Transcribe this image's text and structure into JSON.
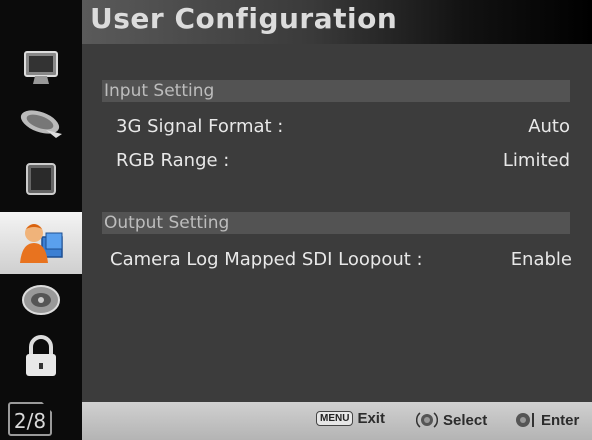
{
  "header": {
    "title": "User Configuration"
  },
  "sidebar": {
    "items": [
      {
        "icon": "monitor-icon"
      },
      {
        "icon": "satellite-dish-icon"
      },
      {
        "icon": "display-screen-icon"
      },
      {
        "icon": "user-config-icon",
        "active": true
      },
      {
        "icon": "settings-disc-icon"
      },
      {
        "icon": "lock-icon"
      }
    ],
    "page_indicator": "2/8"
  },
  "sections": {
    "input": {
      "title": "Input Setting",
      "rows": [
        {
          "label": "3G Signal Format :",
          "value": "Auto"
        },
        {
          "label": "RGB Range :",
          "value": "Limited"
        }
      ]
    },
    "output": {
      "title": "Output Setting",
      "rows": [
        {
          "label": "Camera Log Mapped SDI Loopout :",
          "value": "Enable"
        }
      ]
    }
  },
  "footer": {
    "menu_key": "MENU",
    "exit": "Exit",
    "select": "Select",
    "enter": "Enter"
  },
  "colors": {
    "active_tab": "#e6e6e6",
    "panel": "#3c3c3c",
    "section_bar": "#535353"
  }
}
